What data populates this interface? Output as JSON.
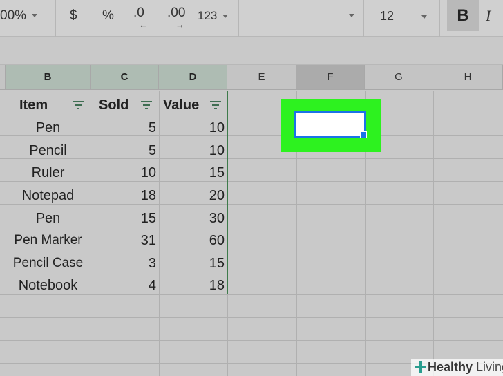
{
  "toolbar": {
    "zoom": "00%",
    "currency": "$",
    "percent": "%",
    "decrease_decimal": ".0",
    "increase_decimal": ".00",
    "more_formats": "123",
    "font_size": "12",
    "bold": "B",
    "italic": "I"
  },
  "columns": [
    "B",
    "C",
    "D",
    "E",
    "F",
    "G",
    "H"
  ],
  "table": {
    "headers": [
      "Item",
      "Sold",
      "Value"
    ],
    "rows": [
      {
        "item": "Pen",
        "sold": "5",
        "value": "10"
      },
      {
        "item": "Pencil",
        "sold": "5",
        "value": "10"
      },
      {
        "item": "Ruler",
        "sold": "10",
        "value": "15"
      },
      {
        "item": "Notepad",
        "sold": "18",
        "value": "20"
      },
      {
        "item": "Pen",
        "sold": "15",
        "value": "30"
      },
      {
        "item": "Pen Marker",
        "sold": "31",
        "value": "60"
      },
      {
        "item": "Pencil Case",
        "sold": "3",
        "value": "15"
      },
      {
        "item": "Notebook",
        "sold": "4",
        "value": "18"
      }
    ]
  },
  "watermark": {
    "bold": "Healthy",
    "light": " Living"
  },
  "colors": {
    "selection": "#1a73e8",
    "highlight": "#2df21f",
    "range_border": "#3d7a4a"
  }
}
